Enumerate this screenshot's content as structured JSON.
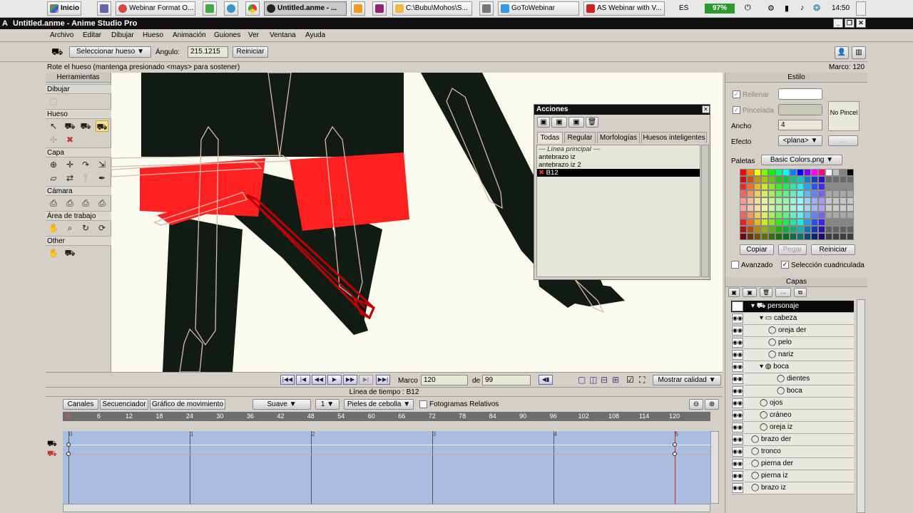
{
  "taskbar": {
    "start": "Inicio",
    "items": [
      "Webinar Format O...",
      "Untitled.anme - ...",
      "C:\\Bubu\\Mohos\\S...",
      "GoToWebinar",
      "AS Webinar with V..."
    ],
    "lang": "ES",
    "battery": "97%",
    "time": "14:50"
  },
  "window": {
    "title": "Untitled.anme - Anime Studio Pro"
  },
  "menu": [
    "Archivo",
    "Editar",
    "Dibujar",
    "Hueso",
    "Animación",
    "Guiones",
    "Ver",
    "Ventana",
    "Ayuda"
  ],
  "tooloptions": {
    "select_bone": "Seleccionar hueso",
    "angle_label": "Ángulo:",
    "angle_value": "215.1215",
    "reset": "Reiniciar"
  },
  "status": {
    "hint": "Rote el hueso (mantenga presionado <mays> para sostener)",
    "frame": "Marco: 120"
  },
  "tools": {
    "title": "Herramientas",
    "sections": [
      "Dibujar",
      "Hueso",
      "Capa",
      "Cámara",
      "Área de trabajo",
      "Other"
    ]
  },
  "actions": {
    "title": "Acciones",
    "tabs": [
      "Todas",
      "Regular",
      "Morfologías",
      "Huesos inteligentes"
    ],
    "items": [
      "--- Línea principal ---",
      "antebrazo iz",
      "antebrazo iz 2",
      "B12"
    ]
  },
  "playback": {
    "frame_label": "Marco",
    "frame_value": "120",
    "of_label": "de",
    "of_value": "99",
    "quality": "Mostrar calidad"
  },
  "timeline": {
    "title": "Línea de tiempo : B12",
    "tabs": [
      "Canales",
      "Secuenciador",
      "Gráfico de movimiento"
    ],
    "interp": "Suave",
    "interp_n": "1",
    "onion": "Pieles de cebolla",
    "relative": "Fotogramas Relativos",
    "ruler": [
      "0",
      "6",
      "12",
      "18",
      "24",
      "30",
      "36",
      "42",
      "48",
      "54",
      "60",
      "66",
      "72",
      "78",
      "84",
      "90",
      "96",
      "102",
      "108",
      "114",
      "120"
    ],
    "seconds": [
      "0",
      "1",
      "2",
      "3",
      "4",
      "5"
    ]
  },
  "style": {
    "title": "Estilo",
    "fill": "Rellenar",
    "stroke": "Pincelada",
    "width_label": "Ancho",
    "width_value": "4",
    "effect_label": "Efecto",
    "effect_value": "<plana>",
    "no_brush": "No Pincel",
    "palettes_label": "Paletas",
    "palette_value": "Basic Colors.png",
    "copy": "Copiar",
    "paste": "Pegar",
    "reset": "Reiniciar",
    "advanced": "Avanzado",
    "grid_select": "Selección cuadriculada"
  },
  "layers": {
    "title": "Capas",
    "items": [
      {
        "name": "personaje",
        "depth": 0,
        "kind": "bone-group",
        "selected": true
      },
      {
        "name": "cabeza",
        "depth": 1,
        "kind": "folder"
      },
      {
        "name": "oreja der",
        "depth": 2,
        "kind": "vector"
      },
      {
        "name": "pelo",
        "depth": 2,
        "kind": "vector"
      },
      {
        "name": "nariz",
        "depth": 2,
        "kind": "vector"
      },
      {
        "name": "boca",
        "depth": 1,
        "kind": "switch"
      },
      {
        "name": "dientes",
        "depth": 3,
        "kind": "vector"
      },
      {
        "name": "boca",
        "depth": 3,
        "kind": "vector"
      },
      {
        "name": "ojos",
        "depth": 1,
        "kind": "vector"
      },
      {
        "name": "cráneo",
        "depth": 1,
        "kind": "vector"
      },
      {
        "name": "oreja iz",
        "depth": 1,
        "kind": "vector"
      },
      {
        "name": "brazo der",
        "depth": 0,
        "kind": "vector"
      },
      {
        "name": "tronco",
        "depth": 0,
        "kind": "vector"
      },
      {
        "name": "pierna der",
        "depth": 0,
        "kind": "vector"
      },
      {
        "name": "pierna iz",
        "depth": 0,
        "kind": "vector"
      },
      {
        "name": "brazo iz",
        "depth": 0,
        "kind": "vector"
      }
    ]
  },
  "colors": {
    "accent_bone": "#c00000",
    "red_shape": "#ff2020",
    "dark_shape": "#121a14",
    "timeline_track": "#a9bde0"
  }
}
